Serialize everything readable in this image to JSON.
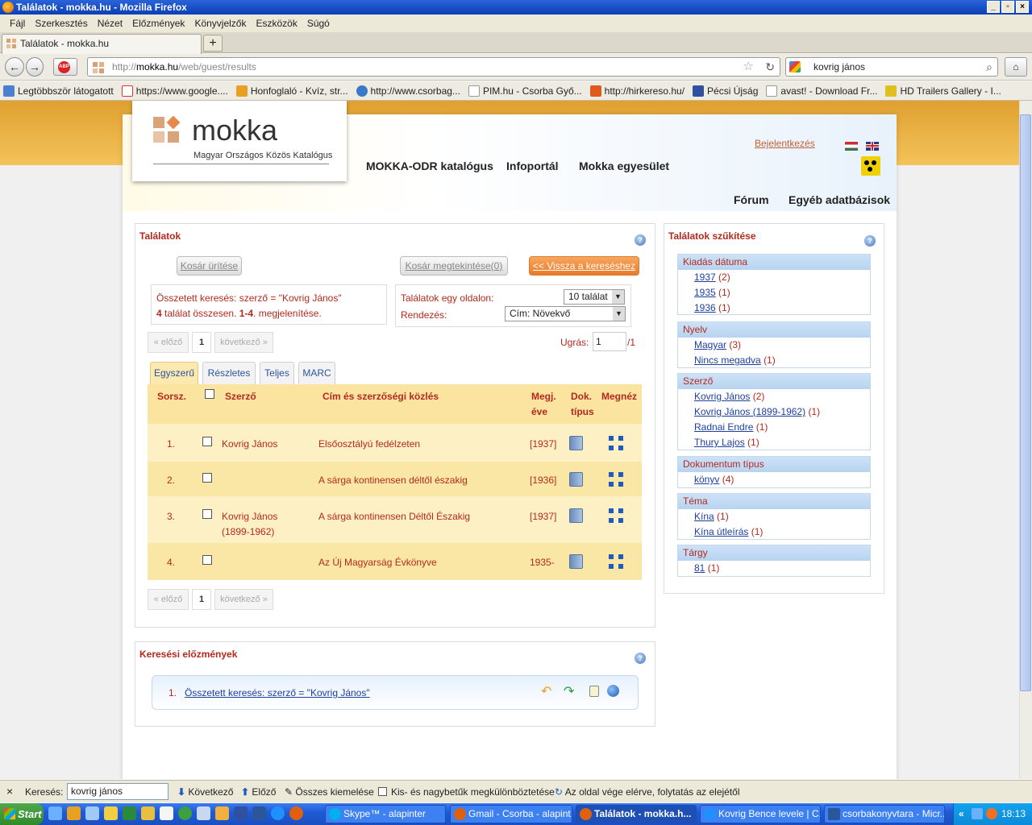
{
  "window": {
    "title": "Találatok - mokka.hu - Mozilla Firefox",
    "buttons": [
      "_",
      "▫",
      "×"
    ]
  },
  "menu": [
    "Fájl",
    "Szerkesztés",
    "Nézet",
    "Előzmények",
    "Könyvjelzők",
    "Eszközök",
    "Súgó"
  ],
  "tab": {
    "label": "Találatok - mokka.hu",
    "new_tab": "+"
  },
  "nav": {
    "url_prefix": "http://",
    "url_domain": "mokka.hu",
    "url_path": "/web/guest/results",
    "search_value": "kovrig jános"
  },
  "bookmarks": [
    "Legtöbbször látogatott",
    "https://www.google....",
    "Honfoglaló - Kvíz, str...",
    "http://www.csorbag...",
    "PIM.hu - Csorba Győ...",
    "http://hirkereso.hu/",
    "Pécsi Újság",
    "avast! - Download Fr...",
    "HD Trailers Gallery - I..."
  ],
  "site": {
    "logo_word": "mokka",
    "logo_sub": "Magyar Országos Közös Katalógus",
    "nav": [
      "MOKKA-ODR katalógus",
      "Infoportál",
      "Mokka egyesület"
    ],
    "nav2": [
      "Fórum",
      "Egyéb adatbázisok"
    ],
    "login": "Bejelentkezés"
  },
  "results": {
    "title": "Találatok",
    "btn_empty": "Kosár ürítése",
    "btn_view": "Kosár megtekintése(0)",
    "btn_back": "<< Vissza a kereséshez",
    "query": "Összetett keresés: szerző = \"Kovrig János\"",
    "count_pre": "4",
    "count_mid": " találat összesen. ",
    "count_range": "1-4",
    "count_post": ". megjelenítése.",
    "per_page_label": "Találatok egy oldalon:",
    "per_page_value": "10 találat",
    "sort_label": "Rendezés:",
    "sort_value": "Cím: Növekvő",
    "prev": "« előző",
    "page": "1",
    "next": "következő »",
    "jump_label": "Ugrás:",
    "jump_value": "1",
    "jump_total": "/1",
    "tabs": [
      "Egyszerű",
      "Részletes",
      "Teljes",
      "MARC"
    ],
    "headers": {
      "no": "Sorsz.",
      "author": "Szerző",
      "title": "Cím és szerzőségi közlés",
      "year1": "Megj.",
      "year2": "éve",
      "doc1": "Dok.",
      "doc2": "típus",
      "view": "Megnéz"
    },
    "rows": [
      {
        "no": "1.",
        "author": "Kovrig János",
        "author2": "",
        "title": "Elsőosztályú fedélzeten",
        "year": "[1937]"
      },
      {
        "no": "2.",
        "author": "",
        "author2": "",
        "title": "A sárga kontinensen déltől északig",
        "year": "[1936]"
      },
      {
        "no": "3.",
        "author": "Kovrig János",
        "author2": "(1899-1962)",
        "title": "A sárga kontinensen Déltől Északig",
        "year": "[1937]"
      },
      {
        "no": "4.",
        "author": "",
        "author2": "",
        "title": "Az Új Magyarság Évkönyve",
        "year": "1935-"
      }
    ]
  },
  "history": {
    "title": "Keresési előzmények",
    "item_no": "1.",
    "item": "Összetett keresés: szerző = \"Kovrig János\""
  },
  "facets": {
    "title": "Találatok szűkítése",
    "groups": [
      {
        "name": "Kiadás dátuma",
        "items": [
          {
            "label": "1937",
            "count": "(2)"
          },
          {
            "label": "1935",
            "count": "(1)"
          },
          {
            "label": "1936",
            "count": "(1)"
          }
        ]
      },
      {
        "name": "Nyelv",
        "items": [
          {
            "label": "Magyar",
            "count": "(3)"
          },
          {
            "label": "Nincs megadva",
            "count": "(1)"
          }
        ]
      },
      {
        "name": "Szerző",
        "items": [
          {
            "label": "Kovrig János",
            "count": "(2)"
          },
          {
            "label": "Kovrig János (1899-1962)",
            "count": "(1)"
          },
          {
            "label": "Radnai Endre",
            "count": "(1)"
          },
          {
            "label": "Thury Lajos",
            "count": "(1)"
          }
        ]
      },
      {
        "name": "Dokumentum típus",
        "items": [
          {
            "label": "könyv",
            "count": "(4)"
          }
        ]
      },
      {
        "name": "Téma",
        "items": [
          {
            "label": "Kína",
            "count": "(1)"
          },
          {
            "label": "Kína útleírás",
            "count": "(1)"
          }
        ]
      },
      {
        "name": "Tárgy",
        "items": [
          {
            "label": "81",
            "count": "(1)"
          }
        ]
      }
    ]
  },
  "findbar": {
    "close": "×",
    "label": "Keresés:",
    "value": "kovrig jános",
    "next": "Következő",
    "prev": "Előző",
    "highlight": "Összes kiemelése",
    "case": "Kis- és nagybetűk megkülönböztetése",
    "status": "Az oldal vége elérve, folytatás az elejétől"
  },
  "taskbar": {
    "start": "Start",
    "tasks": [
      "Skype™ - alapinter",
      "Gmail - Csorba - alapint...",
      "Találatok - mokka.h...",
      "Kovrig Bence levele | C...",
      "csorbakonyvtara - Micr..."
    ],
    "clock": "18:13"
  },
  "colors": {
    "accent": "#b5291d",
    "link": "#1d3fa0",
    "orange": "#e97b2a",
    "table_bg": "#fdf0c4"
  }
}
